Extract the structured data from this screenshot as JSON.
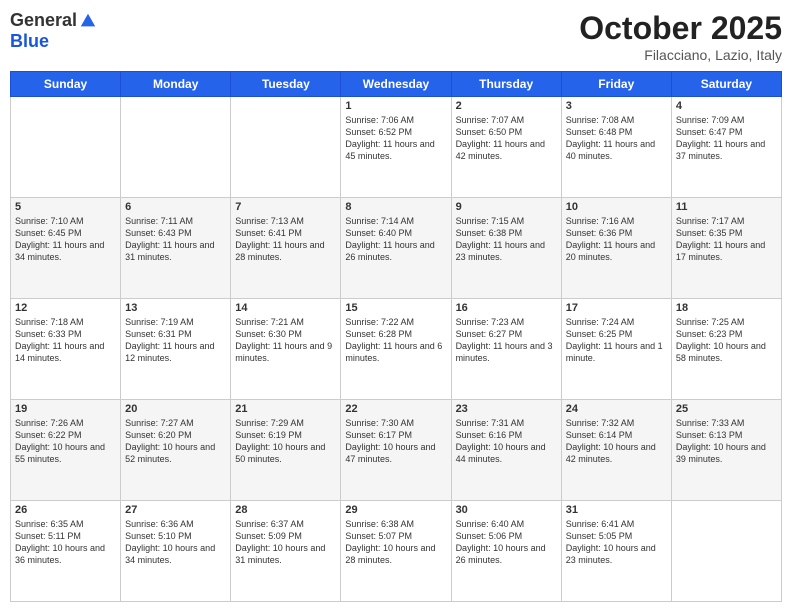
{
  "logo": {
    "general": "General",
    "blue": "Blue"
  },
  "title": "October 2025",
  "location": "Filacciano, Lazio, Italy",
  "days_of_week": [
    "Sunday",
    "Monday",
    "Tuesday",
    "Wednesday",
    "Thursday",
    "Friday",
    "Saturday"
  ],
  "weeks": [
    [
      {
        "day": "",
        "info": ""
      },
      {
        "day": "",
        "info": ""
      },
      {
        "day": "",
        "info": ""
      },
      {
        "day": "1",
        "info": "Sunrise: 7:06 AM\nSunset: 6:52 PM\nDaylight: 11 hours and 45 minutes."
      },
      {
        "day": "2",
        "info": "Sunrise: 7:07 AM\nSunset: 6:50 PM\nDaylight: 11 hours and 42 minutes."
      },
      {
        "day": "3",
        "info": "Sunrise: 7:08 AM\nSunset: 6:48 PM\nDaylight: 11 hours and 40 minutes."
      },
      {
        "day": "4",
        "info": "Sunrise: 7:09 AM\nSunset: 6:47 PM\nDaylight: 11 hours and 37 minutes."
      }
    ],
    [
      {
        "day": "5",
        "info": "Sunrise: 7:10 AM\nSunset: 6:45 PM\nDaylight: 11 hours and 34 minutes."
      },
      {
        "day": "6",
        "info": "Sunrise: 7:11 AM\nSunset: 6:43 PM\nDaylight: 11 hours and 31 minutes."
      },
      {
        "day": "7",
        "info": "Sunrise: 7:13 AM\nSunset: 6:41 PM\nDaylight: 11 hours and 28 minutes."
      },
      {
        "day": "8",
        "info": "Sunrise: 7:14 AM\nSunset: 6:40 PM\nDaylight: 11 hours and 26 minutes."
      },
      {
        "day": "9",
        "info": "Sunrise: 7:15 AM\nSunset: 6:38 PM\nDaylight: 11 hours and 23 minutes."
      },
      {
        "day": "10",
        "info": "Sunrise: 7:16 AM\nSunset: 6:36 PM\nDaylight: 11 hours and 20 minutes."
      },
      {
        "day": "11",
        "info": "Sunrise: 7:17 AM\nSunset: 6:35 PM\nDaylight: 11 hours and 17 minutes."
      }
    ],
    [
      {
        "day": "12",
        "info": "Sunrise: 7:18 AM\nSunset: 6:33 PM\nDaylight: 11 hours and 14 minutes."
      },
      {
        "day": "13",
        "info": "Sunrise: 7:19 AM\nSunset: 6:31 PM\nDaylight: 11 hours and 12 minutes."
      },
      {
        "day": "14",
        "info": "Sunrise: 7:21 AM\nSunset: 6:30 PM\nDaylight: 11 hours and 9 minutes."
      },
      {
        "day": "15",
        "info": "Sunrise: 7:22 AM\nSunset: 6:28 PM\nDaylight: 11 hours and 6 minutes."
      },
      {
        "day": "16",
        "info": "Sunrise: 7:23 AM\nSunset: 6:27 PM\nDaylight: 11 hours and 3 minutes."
      },
      {
        "day": "17",
        "info": "Sunrise: 7:24 AM\nSunset: 6:25 PM\nDaylight: 11 hours and 1 minute."
      },
      {
        "day": "18",
        "info": "Sunrise: 7:25 AM\nSunset: 6:23 PM\nDaylight: 10 hours and 58 minutes."
      }
    ],
    [
      {
        "day": "19",
        "info": "Sunrise: 7:26 AM\nSunset: 6:22 PM\nDaylight: 10 hours and 55 minutes."
      },
      {
        "day": "20",
        "info": "Sunrise: 7:27 AM\nSunset: 6:20 PM\nDaylight: 10 hours and 52 minutes."
      },
      {
        "day": "21",
        "info": "Sunrise: 7:29 AM\nSunset: 6:19 PM\nDaylight: 10 hours and 50 minutes."
      },
      {
        "day": "22",
        "info": "Sunrise: 7:30 AM\nSunset: 6:17 PM\nDaylight: 10 hours and 47 minutes."
      },
      {
        "day": "23",
        "info": "Sunrise: 7:31 AM\nSunset: 6:16 PM\nDaylight: 10 hours and 44 minutes."
      },
      {
        "day": "24",
        "info": "Sunrise: 7:32 AM\nSunset: 6:14 PM\nDaylight: 10 hours and 42 minutes."
      },
      {
        "day": "25",
        "info": "Sunrise: 7:33 AM\nSunset: 6:13 PM\nDaylight: 10 hours and 39 minutes."
      }
    ],
    [
      {
        "day": "26",
        "info": "Sunrise: 6:35 AM\nSunset: 5:11 PM\nDaylight: 10 hours and 36 minutes."
      },
      {
        "day": "27",
        "info": "Sunrise: 6:36 AM\nSunset: 5:10 PM\nDaylight: 10 hours and 34 minutes."
      },
      {
        "day": "28",
        "info": "Sunrise: 6:37 AM\nSunset: 5:09 PM\nDaylight: 10 hours and 31 minutes."
      },
      {
        "day": "29",
        "info": "Sunrise: 6:38 AM\nSunset: 5:07 PM\nDaylight: 10 hours and 28 minutes."
      },
      {
        "day": "30",
        "info": "Sunrise: 6:40 AM\nSunset: 5:06 PM\nDaylight: 10 hours and 26 minutes."
      },
      {
        "day": "31",
        "info": "Sunrise: 6:41 AM\nSunset: 5:05 PM\nDaylight: 10 hours and 23 minutes."
      },
      {
        "day": "",
        "info": ""
      }
    ]
  ]
}
